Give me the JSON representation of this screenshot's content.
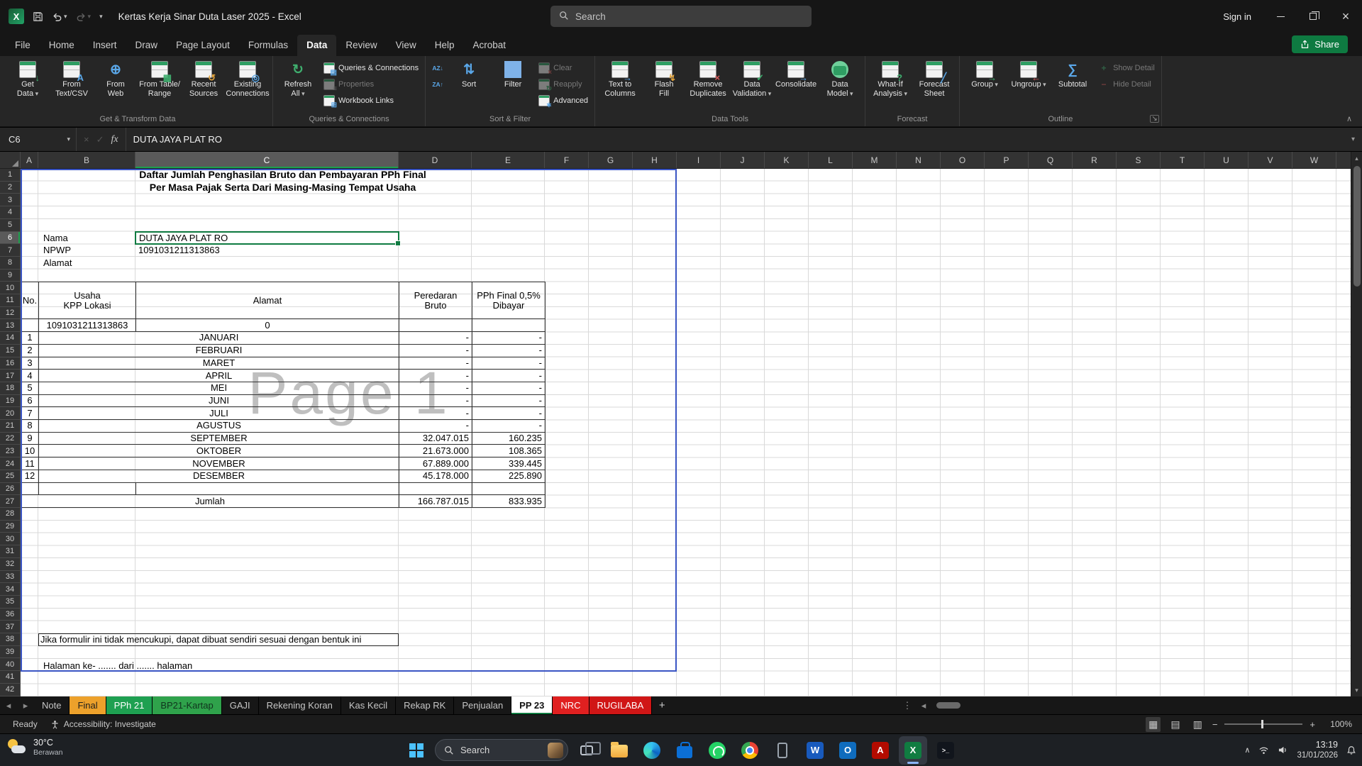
{
  "titlebar": {
    "app_title": "Kertas Kerja Sinar Duta Laser 2025 - Excel",
    "search_placeholder": "Search",
    "sign_in": "Sign in"
  },
  "menubar": {
    "tabs": [
      "File",
      "Home",
      "Insert",
      "Draw",
      "Page Layout",
      "Formulas",
      "Data",
      "Review",
      "View",
      "Help",
      "Acrobat"
    ],
    "active_tab": "Data",
    "share_label": "Share"
  },
  "ribbon": {
    "groups": [
      {
        "label": "Get & Transform Data",
        "items": [
          {
            "label": "Get\nData",
            "icon": "get-data",
            "dd": true
          },
          {
            "label": "From\nText/CSV",
            "icon": "text-csv"
          },
          {
            "label": "From\nWeb",
            "icon": "web"
          },
          {
            "label": "From Table/\nRange",
            "icon": "table-range"
          },
          {
            "label": "Recent\nSources",
            "icon": "recent"
          },
          {
            "label": "Existing\nConnections",
            "icon": "connections"
          }
        ]
      },
      {
        "label": "Queries & Connections",
        "items": [
          {
            "label": "Refresh\nAll",
            "icon": "refresh",
            "dd": true
          },
          {
            "col": [
              {
                "label": "Queries & Connections",
                "icon": "queries"
              },
              {
                "label": "Properties",
                "icon": "properties",
                "disabled": true
              },
              {
                "label": "Workbook Links",
                "icon": "links"
              }
            ]
          }
        ]
      },
      {
        "label": "Sort & Filter",
        "items": [
          {
            "col": [
              {
                "label": "",
                "icon": "sort-az"
              },
              {
                "label": "",
                "icon": "sort-za"
              }
            ]
          },
          {
            "label": "Sort",
            "icon": "sort"
          },
          {
            "label": "Filter",
            "icon": "filter"
          },
          {
            "col": [
              {
                "label": "Clear",
                "icon": "clear",
                "disabled": true
              },
              {
                "label": "Reapply",
                "icon": "reapply",
                "disabled": true
              },
              {
                "label": "Advanced",
                "icon": "advanced"
              }
            ]
          }
        ]
      },
      {
        "label": "Data Tools",
        "items": [
          {
            "label": "Text to\nColumns",
            "icon": "text-columns"
          },
          {
            "label": "Flash\nFill",
            "icon": "flash-fill"
          },
          {
            "label": "Remove\nDuplicates",
            "icon": "remove-dup"
          },
          {
            "label": "Data\nValidation",
            "icon": "validation",
            "dd": true
          },
          {
            "label": "Consolidate",
            "icon": "consolidate"
          },
          {
            "label": "Data\nModel",
            "icon": "data-model",
            "dd": true
          }
        ]
      },
      {
        "label": "Forecast",
        "items": [
          {
            "label": "What-If\nAnalysis",
            "icon": "what-if",
            "dd": true
          },
          {
            "label": "Forecast\nSheet",
            "icon": "forecast"
          }
        ]
      },
      {
        "label": "Outline",
        "launcher": true,
        "items": [
          {
            "label": "Group",
            "icon": "group",
            "dd": true
          },
          {
            "label": "Ungroup",
            "icon": "ungroup",
            "dd": true
          },
          {
            "label": "Subtotal",
            "icon": "subtotal"
          },
          {
            "col": [
              {
                "label": "Show Detail",
                "icon": "show-detail",
                "disabled": true
              },
              {
                "label": "Hide Detail",
                "icon": "hide-detail",
                "disabled": true
              }
            ]
          }
        ]
      }
    ]
  },
  "formula_bar": {
    "name_box": "C6",
    "value": "DUTA JAYA PLAT RO"
  },
  "sheet": {
    "columns": [
      "A",
      "B",
      "C",
      "D",
      "E",
      "F",
      "G",
      "H",
      "I",
      "J",
      "K",
      "L",
      "M",
      "N",
      "O",
      "P",
      "Q",
      "R",
      "S",
      "T",
      "U",
      "V",
      "W"
    ],
    "row_count": 42,
    "selected": {
      "col": "C",
      "row": 6
    },
    "title1": "Daftar Jumlah Penghasilan Bruto dan Pembayaran PPh Final",
    "title2": "Per Masa Pajak Serta Dari Masing-Masing Tempat Usaha",
    "labels": {
      "nama": "Nama",
      "npwp": "NPWP",
      "alamat": "Alamat"
    },
    "values": {
      "nama": "DUTA JAYA PLAT RO",
      "npwp": "1091031211313863"
    },
    "table": {
      "h_no": "No.",
      "h_usaha": "Usaha",
      "h_kpp": "KPP Lokasi",
      "h_alamat": "Alamat",
      "h_peredaran": "Peredaran",
      "h_bruto": "Bruto",
      "h_pph": "PPh Final 0,5%",
      "h_dibayar": "Dibayar",
      "npwp": "1091031211313863",
      "kode": "0",
      "months": [
        {
          "no": "1",
          "name": "JANUARI",
          "bruto": "-",
          "pph": "-"
        },
        {
          "no": "2",
          "name": "FEBRUARI",
          "bruto": "-",
          "pph": "-"
        },
        {
          "no": "3",
          "name": "MARET",
          "bruto": "-",
          "pph": "-"
        },
        {
          "no": "4",
          "name": "APRIL",
          "bruto": "-",
          "pph": "-"
        },
        {
          "no": "5",
          "name": "MEI",
          "bruto": "-",
          "pph": "-"
        },
        {
          "no": "6",
          "name": "JUNI",
          "bruto": "-",
          "pph": "-"
        },
        {
          "no": "7",
          "name": "JULI",
          "bruto": "-",
          "pph": "-"
        },
        {
          "no": "8",
          "name": "AGUSTUS",
          "bruto": "-",
          "pph": "-"
        },
        {
          "no": "9",
          "name": "SEPTEMBER",
          "bruto": "32.047.015",
          "pph": "160.235"
        },
        {
          "no": "10",
          "name": "OKTOBER",
          "bruto": "21.673.000",
          "pph": "108.365"
        },
        {
          "no": "11",
          "name": "NOVEMBER",
          "bruto": "67.889.000",
          "pph": "339.445"
        },
        {
          "no": "12",
          "name": "DESEMBER",
          "bruto": "45.178.000",
          "pph": "225.890"
        }
      ],
      "jumlah_label": "Jumlah",
      "jumlah_bruto": "166.787.015",
      "jumlah_pph": "833.935"
    },
    "note": "Jika formulir ini tidak mencukupi, dapat dibuat sendiri sesuai dengan bentuk ini",
    "halaman": "Halaman ke- ....... dari ....... halaman",
    "watermark": "Page 1"
  },
  "sheet_tabs": {
    "tabs": [
      {
        "label": "Note"
      },
      {
        "label": "Final",
        "bg": "#EDA12B",
        "fg": "#1d1d1d"
      },
      {
        "label": "PPh 21",
        "bg": "#1EA051",
        "fg": "#ffffff"
      },
      {
        "label": "BP21-Kartap",
        "bg": "#2FA24B",
        "fg": "#10331d"
      },
      {
        "label": "GAJI"
      },
      {
        "label": "Rekening Koran"
      },
      {
        "label": "Kas Kecil"
      },
      {
        "label": "Rekap RK"
      },
      {
        "label": "Penjualan"
      },
      {
        "label": "PP 23",
        "active": true
      },
      {
        "label": "NRC",
        "bg": "#E02020",
        "fg": "#ffffff"
      },
      {
        "label": "RUGILABA",
        "bg": "#D01616",
        "fg": "#ffffff"
      }
    ],
    "add_label": "+"
  },
  "status_bar": {
    "ready": "Ready",
    "accessibility": "Accessibility: Investigate",
    "zoom_level": "100%"
  },
  "taskbar": {
    "weather_temp": "30°C",
    "weather_desc": "Berawan",
    "search_label": "Search",
    "apps": [
      {
        "name": "start"
      },
      {
        "name": "search"
      },
      {
        "name": "task-view"
      },
      {
        "name": "file-explorer"
      },
      {
        "name": "edge"
      },
      {
        "name": "store"
      },
      {
        "name": "whatsapp"
      },
      {
        "name": "chrome"
      },
      {
        "name": "phone-link"
      },
      {
        "name": "word"
      },
      {
        "name": "outlook"
      },
      {
        "name": "acrobat"
      },
      {
        "name": "excel",
        "active": true
      },
      {
        "name": "terminal"
      }
    ],
    "time": "13:19",
    "date": "31/01/2026"
  }
}
